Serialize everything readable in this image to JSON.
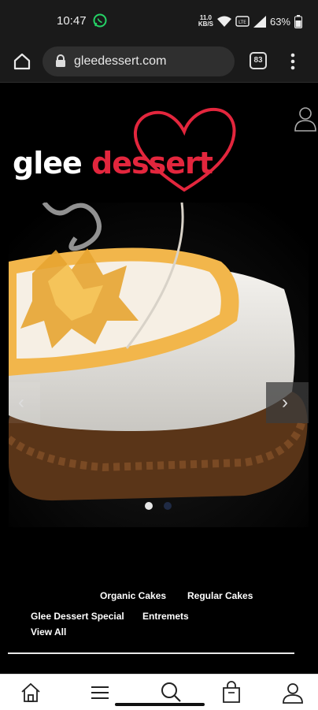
{
  "status_bar": {
    "time": "10:47",
    "network_speed": "11.0\nKB/S",
    "battery_percent": "63%",
    "whatsapp_icon": "whatsapp-icon",
    "wifi_icon": "wifi-icon",
    "signal_icon": "signal-icon",
    "battery_icon": "battery-icon"
  },
  "browser": {
    "url": "gleedessert.com",
    "tab_count": "83",
    "home_icon": "home-icon",
    "lock_icon": "lock-icon",
    "menu_icon": "kebab-menu-icon"
  },
  "site": {
    "logo_word1": "glee",
    "logo_word2": "dessert",
    "logo_color": "#e3263d",
    "user_icon": "user-icon"
  },
  "slider": {
    "prev_label": "‹",
    "next_label": "›",
    "active_index": 1,
    "slides": 2
  },
  "nav": {
    "organic_cakes": "Organic Cakes",
    "regular_cakes": "Regular Cakes",
    "glee_special": "Glee Dessert Special",
    "entremets": "Entremets",
    "view_all": "View All"
  },
  "bottom_nav": {
    "items": [
      "home-icon",
      "menu-icon",
      "search-icon",
      "bag-icon",
      "account-icon"
    ]
  }
}
